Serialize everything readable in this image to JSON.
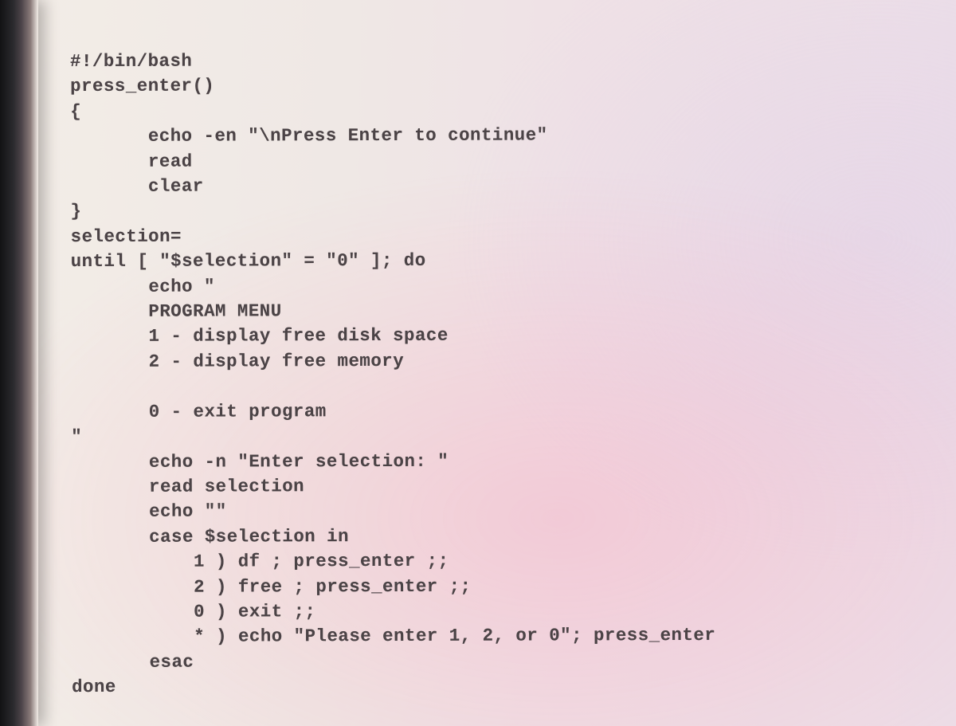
{
  "code_lines": [
    "#!/bin/bash",
    "press_enter()",
    "{",
    "       echo -en \"\\nPress Enter to continue\"",
    "       read",
    "       clear",
    "}",
    "selection=",
    "until [ \"$selection\" = \"0\" ]; do",
    "       echo \"",
    "       PROGRAM MENU",
    "       1 - display free disk space",
    "       2 - display free memory",
    "",
    "       0 - exit program",
    "\"",
    "       echo -n \"Enter selection: \"",
    "       read selection",
    "       echo \"\"",
    "       case $selection in",
    "           1 ) df ; press_enter ;;",
    "           2 ) free ; press_enter ;;",
    "           0 ) exit ;;",
    "           * ) echo \"Please enter 1, 2, or 0\"; press_enter",
    "       esac",
    "done"
  ]
}
